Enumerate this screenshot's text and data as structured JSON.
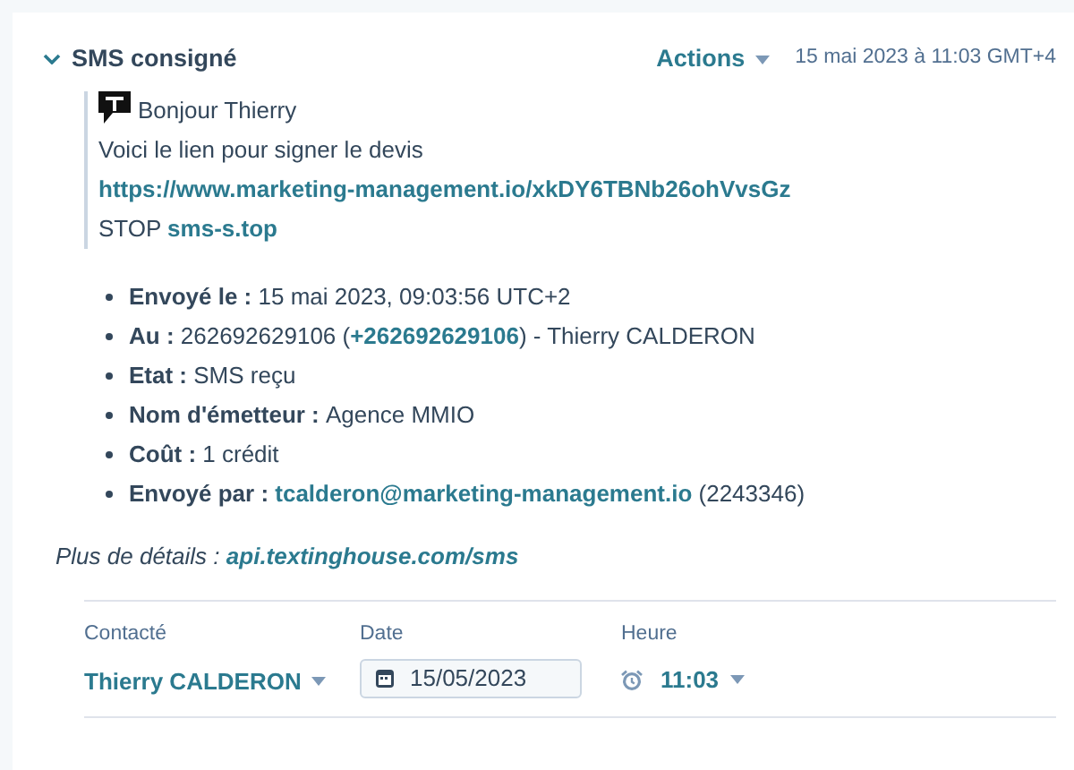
{
  "header": {
    "title": "SMS consigné",
    "expanded": true,
    "actions": "Actions",
    "timestamp": "15 mai 2023 à 11:03 GMT+4"
  },
  "message": [
    [
      {
        "kind": "plain",
        "text": "Bonjour Thierry"
      }
    ],
    [
      {
        "kind": "plain",
        "text": "Voici le lien pour signer le devis"
      }
    ],
    [
      {
        "kind": "link",
        "text": "https://www.marketing-management.io/xkDY6TBNb26ohVvsGz"
      }
    ],
    [
      {
        "kind": "plain",
        "text": "STOP "
      },
      {
        "kind": "link",
        "text": "sms-s.top"
      }
    ]
  ],
  "details": [
    {
      "label": "Envoyé le :",
      "parts": [
        {
          "kind": "plain",
          "text": "15 mai 2023, 09:03:56 UTC+2"
        }
      ]
    },
    {
      "label": "Au :",
      "parts": [
        {
          "kind": "plain",
          "text": "262692629106 ("
        },
        {
          "kind": "link",
          "text": "+262692629106"
        },
        {
          "kind": "plain",
          "text": ") - Thierry CALDERON"
        }
      ]
    },
    {
      "label": "Etat :",
      "parts": [
        {
          "kind": "plain",
          "text": "SMS reçu"
        }
      ]
    },
    {
      "label": "Nom d'émetteur :",
      "parts": [
        {
          "kind": "plain",
          "text": "Agence MMIO"
        }
      ]
    },
    {
      "label": "Coût :",
      "parts": [
        {
          "kind": "plain",
          "text": "1 crédit"
        }
      ]
    },
    {
      "label": "Envoyé par :",
      "parts": [
        {
          "kind": "link",
          "text": "tcalderon@marketing-management.io"
        },
        {
          "kind": "plain",
          "text": " (2243346)"
        }
      ]
    }
  ],
  "more": {
    "label": "Plus de détails :",
    "link": "api.textinghouse.com/sms"
  },
  "fields": {
    "contact": {
      "label": "Contacté",
      "value": "Thierry CALDERON"
    },
    "date": {
      "label": "Date",
      "value": "15/05/2023"
    },
    "time": {
      "label": "Heure",
      "value": "11:03"
    }
  }
}
